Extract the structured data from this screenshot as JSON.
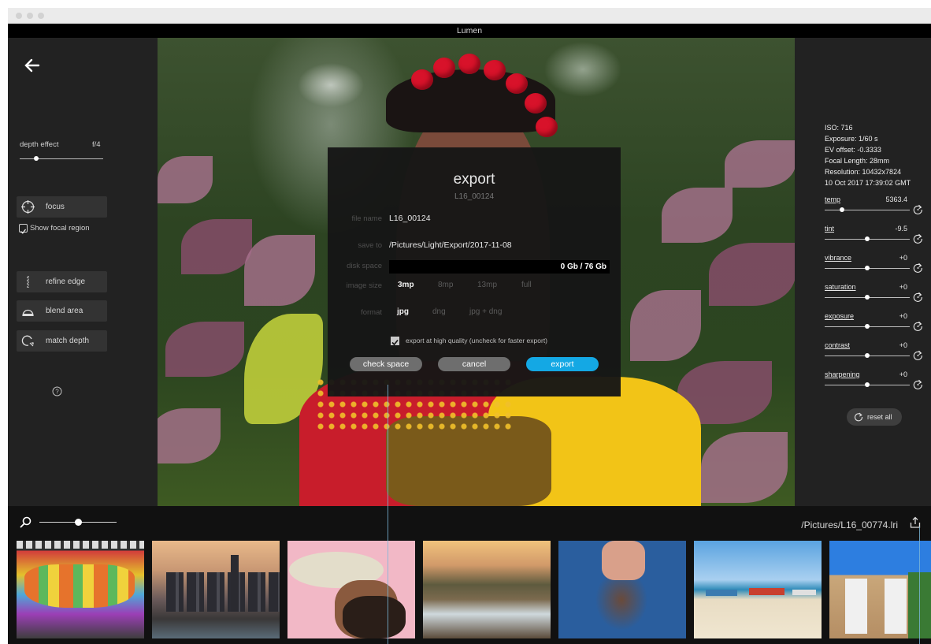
{
  "window": {
    "title": "Lumen"
  },
  "left_panel": {
    "depth_effect_label": "depth effect",
    "depth_effect_value": "f/4",
    "depth_slider_level": 0.2,
    "focus_label": "focus",
    "show_focal_region_label": "Show focal region",
    "show_focal_region_checked": true,
    "tools": [
      {
        "label": "refine edge",
        "icon": "refine-edge-icon"
      },
      {
        "label": "blend area",
        "icon": "blend-area-icon"
      },
      {
        "label": "match depth",
        "icon": "match-depth-icon"
      }
    ]
  },
  "export_dialog": {
    "title": "export",
    "subtitle": "L16_00124",
    "file_name_label": "file name",
    "file_name_value": "L16_00124",
    "save_to_label": "save to",
    "save_to_value": "/Pictures/Light/Export/2017-11-08",
    "disk_space_label": "disk space",
    "disk_space_value": "0 Gb / 76 Gb",
    "image_size_label": "image size",
    "image_size_options": [
      "3mp",
      "8mp",
      "13mp",
      "full"
    ],
    "image_size_selected": "3mp",
    "format_label": "format",
    "format_options": [
      "jpg",
      "dng",
      "jpg + dng"
    ],
    "format_selected": "jpg",
    "high_quality_label": "export at high quality (uncheck for faster export)",
    "high_quality_checked": true,
    "check_space_button": "check space",
    "cancel_button": "cancel",
    "export_button": "export"
  },
  "metadata": {
    "iso": "ISO: 716",
    "exposure": "Exposure: 1/60 s",
    "ev_offset": "EV offset: -0.3333",
    "focal_length": "Focal Length: 28mm",
    "resolution": "Resolution: 10432x7824",
    "date": "10 Oct 2017 17:39:02 GMT"
  },
  "adjustments": [
    {
      "label": "temp",
      "value": "5363.4",
      "level": 0.2
    },
    {
      "label": "tint",
      "value": "-9.5",
      "level": 0.5
    },
    {
      "label": "vibrance",
      "value": "+0",
      "level": 0.5
    },
    {
      "label": "saturation",
      "value": "+0",
      "level": 0.5
    },
    {
      "label": "exposure",
      "value": "+0",
      "level": 0.5
    },
    {
      "label": "contrast",
      "value": "+0",
      "level": 0.5
    },
    {
      "label": "sharpening",
      "value": "+0",
      "level": 0.5
    }
  ],
  "reset_all_label": "reset all",
  "bottom": {
    "zoom_level": 0.5,
    "path": "/Pictures/L16_00774.lri"
  },
  "filmstrip": [
    {
      "subject": "graffiti wall"
    },
    {
      "subject": "city skyline at sunset"
    },
    {
      "subject": "man with hat and sunglasses"
    },
    {
      "subject": "rocky beach at sunset"
    },
    {
      "subject": "woman upside down in pool"
    },
    {
      "subject": "beach with boats"
    },
    {
      "subject": "poolside loungers"
    }
  ],
  "colors": {
    "accent": "#14a8e4",
    "button_gray": "#6e6e6e",
    "panel": "#222222",
    "background": "#1e1e1e"
  }
}
